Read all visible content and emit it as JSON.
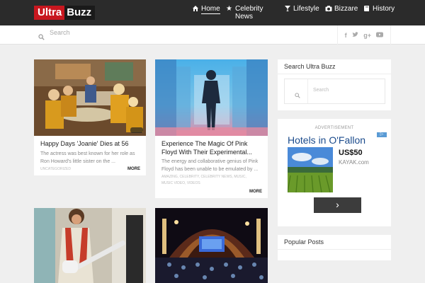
{
  "header": {
    "logo_part1": "Ultra",
    "logo_part2": "Buzz",
    "nav": [
      {
        "label": "Home",
        "icon": "home-icon"
      },
      {
        "label": "Celebrity\nNews",
        "icon": "star-icon"
      },
      {
        "label": "Lifestyle",
        "icon": "cocktail-icon"
      },
      {
        "label": "Bizzare",
        "icon": "camera-icon"
      },
      {
        "label": "History",
        "icon": "book-icon"
      }
    ]
  },
  "search": {
    "placeholder": "Search"
  },
  "social": [
    "f",
    "t",
    "g+",
    "yt"
  ],
  "posts": [
    {
      "title": "Happy Days 'Joanie' Dies at 56",
      "excerpt": "The actress was best known for her role as Ron Howard's little sister on the ...",
      "categories": "UNCATEGORIZED",
      "more": "MORE"
    },
    {
      "title": "Experience The Magic Of Pink Floyd With Their Experimental...",
      "excerpt": "The energy and collaborative genius of Pink Floyd has been unable to be emulated by ...",
      "categories": "AMAZING, CELEBRITY, CELEBRITY NEWS, MUSIC, MUSIC VIDEO, VIDEOS",
      "more": "MORE"
    },
    {
      "title": "",
      "excerpt": "",
      "categories": "",
      "more": ""
    },
    {
      "title": "",
      "excerpt": "",
      "categories": "",
      "more": ""
    }
  ],
  "sidebar": {
    "search_title": "Search Ultra Buzz",
    "search_placeholder": "Search",
    "popular_title": "Popular Posts"
  },
  "ad": {
    "label": "ADVERTISEMENT",
    "title": "Hotels in O'Fallon",
    "price": "US$50",
    "site": "KAYAK.com",
    "button": "›"
  },
  "colors": {
    "topbar": "#2b2b2b",
    "logo_red": "#c8171f",
    "ad_title": "#1b4b8c"
  }
}
